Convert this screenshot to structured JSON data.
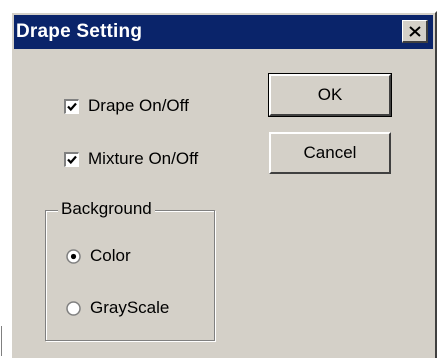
{
  "window": {
    "title": "Drape Setting",
    "close_icon": "close-icon"
  },
  "checkboxes": [
    {
      "label": "Drape On/Off",
      "checked": true
    },
    {
      "label": "Mixture On/Off",
      "checked": true
    }
  ],
  "buttons": {
    "ok_label": "OK",
    "cancel_label": "Cancel"
  },
  "background_group": {
    "legend": "Background",
    "options": [
      {
        "label": "Color",
        "selected": true
      },
      {
        "label": "GrayScale",
        "selected": false
      }
    ]
  },
  "colors": {
    "titlebar": "#0a246a",
    "face": "#d4d0c8"
  }
}
